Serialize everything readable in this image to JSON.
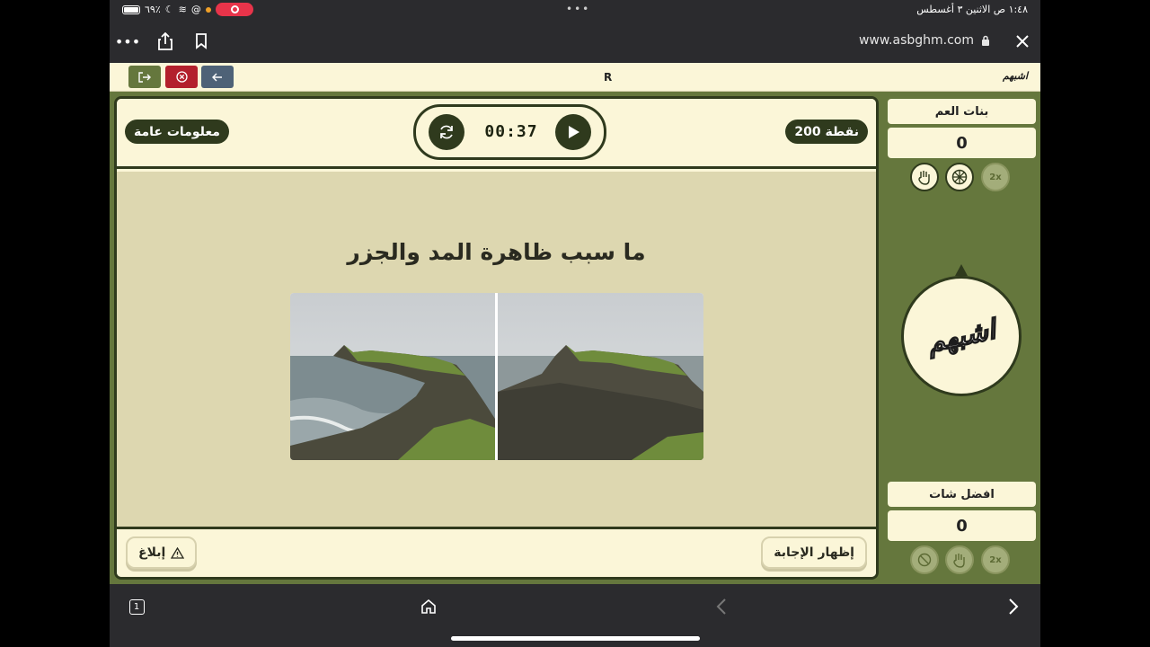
{
  "status_bar": {
    "battery_percent": "٦٩٪",
    "datetime": "١:٤٨ ص  الاثنين ٣ أغسطس"
  },
  "browser": {
    "url": "www.asbghm.com",
    "tab_count": "1"
  },
  "header": {
    "room_code": "R",
    "logo_text": "اشبهم"
  },
  "game": {
    "category": "معلومات عامة",
    "points": "200 نقطة",
    "timer": "00:37",
    "question": "ما سبب ظاهرة المد والجزر",
    "report_label": "إبلاغ",
    "show_answer_label": "إظهار الإجابة"
  },
  "teams": [
    {
      "name": "بنات العم",
      "score": "0",
      "aids": [
        "hand-icon",
        "wheel-icon",
        "2x"
      ]
    },
    {
      "name": "افضل شات",
      "score": "0",
      "aids": [
        "block-icon",
        "hand-icon",
        "2x"
      ]
    }
  ],
  "spinner_logo": "اشبهم",
  "colors": {
    "accent_green": "#65773d",
    "dark_green": "#2f3a1d",
    "cream": "#fbf6d8",
    "body_beige": "#ddd7b0",
    "danger": "#b3202c",
    "slate": "#4e6277"
  }
}
